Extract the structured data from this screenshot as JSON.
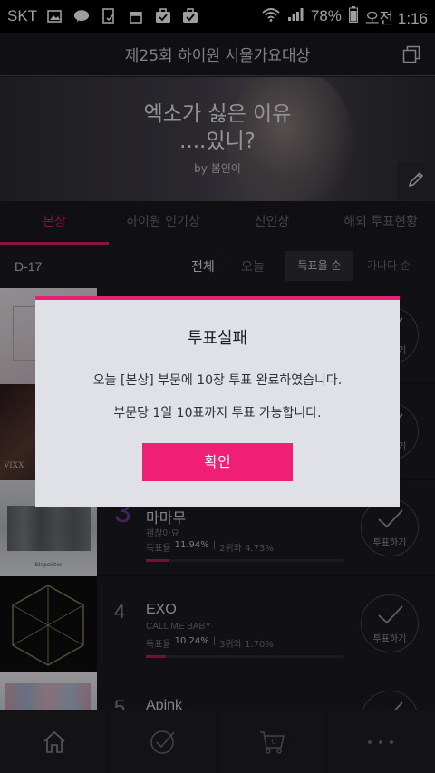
{
  "status_bar": {
    "carrier": "SKT",
    "battery": "78%",
    "time": "오전 1:16"
  },
  "app_bar": {
    "title": "제25회 하이원 서울가요대상"
  },
  "banner": {
    "headline_line1": "엑소가 싫은 이유",
    "headline_line2": "....있니?",
    "byline": "by 봄인이"
  },
  "tabs": [
    {
      "label": "본상",
      "active": true
    },
    {
      "label": "하이원 인기상",
      "active": false
    },
    {
      "label": "신인상",
      "active": false
    },
    {
      "label": "해외 투표현황",
      "active": false
    }
  ],
  "filters": {
    "dday": "D-17",
    "all": "전체",
    "today": "오늘",
    "sort_rate": "득표율 순",
    "sort_alpha": "가나다 순"
  },
  "list": {
    "rank_prefix": "득표율",
    "vote_label": "투표하기",
    "rows": [
      {
        "rank": "3",
        "artist": "마마무",
        "song": "괜찮아요",
        "rate": "11.94%",
        "gap": "2위와 4.73%",
        "fill": 11.94
      },
      {
        "rank": "4",
        "artist": "EXO",
        "song": "CALL ME BABY",
        "rate": "10.24%",
        "gap": "3위와 1.70%",
        "fill": 10.24
      },
      {
        "rank": "5",
        "artist": "Apink",
        "song": "",
        "rate": "",
        "gap": "",
        "fill": 0
      }
    ]
  },
  "thumbnails": {
    "row2_caption": "VIXX",
    "row3_caption": "Stepsister"
  },
  "dialog": {
    "title": "투표실패",
    "message1": "오늘 [본상] 부문에 10장 투표 완료하였습니다.",
    "message2": "부문당 1일 10표까지 투표 가능합니다.",
    "confirm": "확인",
    "accent": "#e81f74"
  }
}
